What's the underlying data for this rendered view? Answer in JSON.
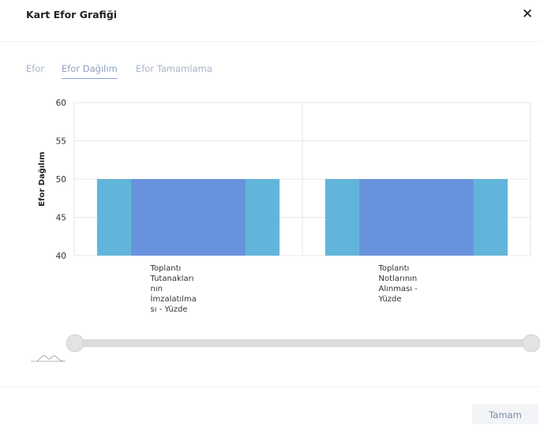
{
  "dialog": {
    "title": "Kart Efor Grafiği",
    "close_glyph": "✕"
  },
  "tabs": [
    {
      "label": "Efor",
      "active": false
    },
    {
      "label": "Efor Dağılım",
      "active": true
    },
    {
      "label": "Efor Tamamlama",
      "active": false
    }
  ],
  "chart_data": {
    "type": "bar",
    "ylabel": "Efor Dağılım",
    "xlabel": "",
    "ylim": [
      40,
      60
    ],
    "yticks": [
      40,
      45,
      50,
      55,
      60
    ],
    "grid": true,
    "categories": [
      "Toplantı Tutanakları nın İmzalatılma sı - Yüzde",
      "Toplantı Notlarının Alınması - Yüzde"
    ],
    "category_lines": [
      [
        "Toplantı",
        "Tutanakları",
        "nın",
        "İmzalatılma",
        "sı - Yüzde"
      ],
      [
        "Toplantı",
        "Notlarının",
        "Alınması -",
        "Yüzde"
      ]
    ],
    "series": [
      {
        "values": [
          50,
          50
        ],
        "color": "#62b5da"
      },
      {
        "values": [
          50,
          50
        ],
        "color": "#6892dc"
      }
    ]
  },
  "footer": {
    "ok_label": "Tamam"
  }
}
